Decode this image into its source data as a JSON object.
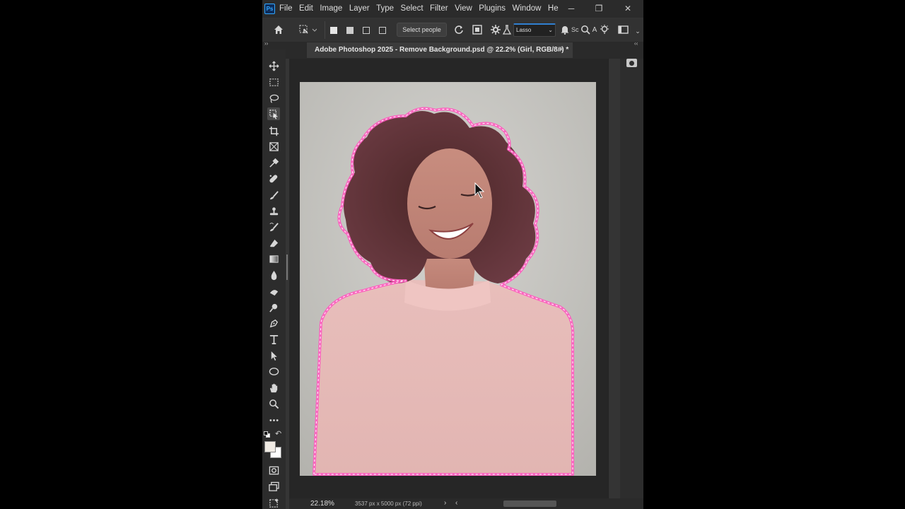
{
  "app": {
    "logo": "Ps"
  },
  "menu": [
    "File",
    "Edit",
    "Image",
    "Layer",
    "Type",
    "Select",
    "Filter",
    "View",
    "Plugins",
    "Window",
    "He"
  ],
  "window_controls": {
    "minimize": "─",
    "restore": "❐",
    "close": "✕"
  },
  "options_bar": {
    "select_people_label": "Select people",
    "mode_value": "Lasso",
    "partial_label": "Sc"
  },
  "document_tab": {
    "title": "Adobe Photoshop 2025 - Remove Background.psd @ 22.2% (Girl, RGB/8#) *",
    "close": "×"
  },
  "panel_collapse": {
    "left": "››",
    "right": "‹‹"
  },
  "status": {
    "zoom": "22.18%",
    "doc_info": "3537 px x 5000 px (72 ppi)",
    "arrow": "›",
    "left_arrow": "‹"
  },
  "toolbar_tools": [
    "move-tool",
    "marquee-tool",
    "lasso-tool",
    "object-selection-tool",
    "crop-tool",
    "frame-tool",
    "eyedropper-tool",
    "spot-healing-tool",
    "brush-tool",
    "clone-stamp-tool",
    "history-brush-tool",
    "eraser-tool",
    "gradient-tool",
    "blur-tool",
    "dodge-tool",
    "sponge-tool",
    "pen-tool",
    "type-tool",
    "path-selection-tool",
    "ellipse-tool",
    "hand-tool",
    "zoom-tool",
    "more-tools"
  ],
  "colors": {
    "foreground": "#f0ebe4",
    "background": "#ffffff",
    "selection_glow": "#ff5cc0",
    "app_bg": "#353535",
    "canvas_bg": "#262626"
  }
}
